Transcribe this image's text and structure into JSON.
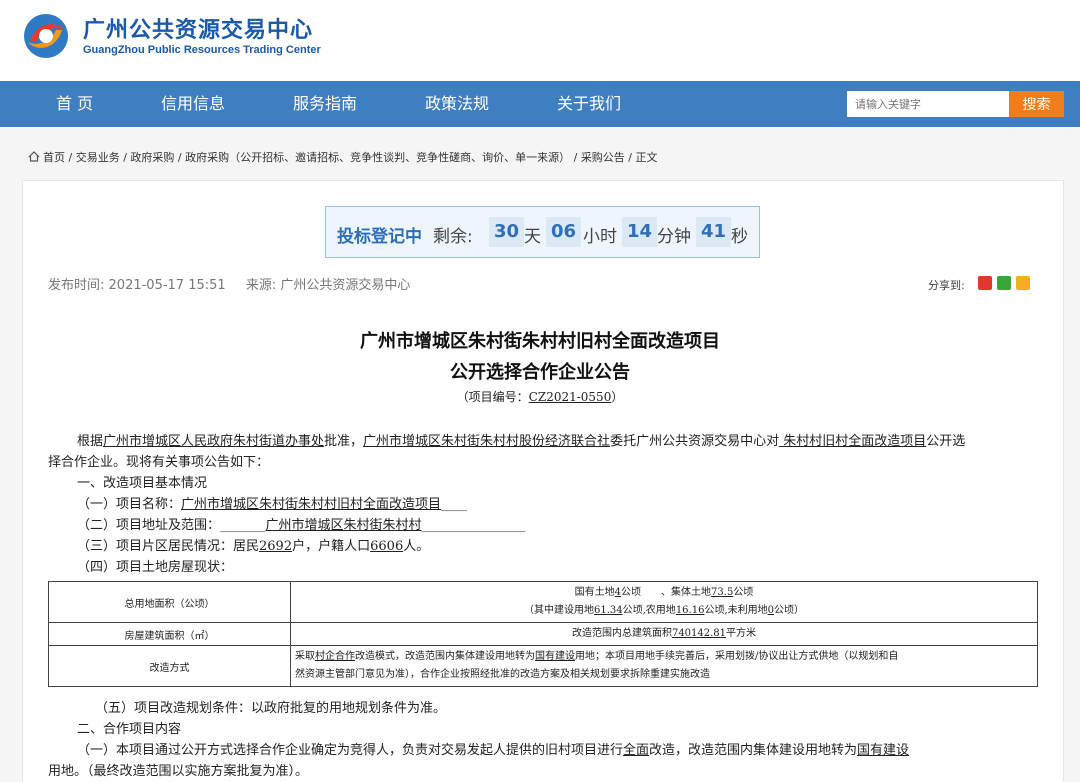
{
  "header": {
    "brand_cn": "广州公共资源交易中心",
    "brand_en": "GuangZhou Public Resources Trading Center"
  },
  "nav": {
    "items": [
      "首 页",
      "信用信息",
      "服务指南",
      "政策法规",
      "关于我们"
    ],
    "search_placeholder": "请输入关键字",
    "search_button": "搜索"
  },
  "breadcrumb": [
    "首页",
    "交易业务",
    "政府采购",
    "政府采购（公开招标、邀请招标、竞争性谈判、竞争性磋商、询价、单一来源）",
    "采购公告",
    "正文"
  ],
  "breadcrumb_sep": " / ",
  "countdown": {
    "title": "投标登记中",
    "remaining_label": "剩余:",
    "days": "30",
    "days_unit": "天",
    "hours": "06",
    "hours_unit": "小时",
    "minutes": "14",
    "minutes_unit": "分钟",
    "seconds": "41",
    "seconds_unit": "秒"
  },
  "meta": {
    "publish_label": "发布时间:",
    "publish_time": "2021-05-17 15:51",
    "source_label": "来源:",
    "source": "广州公共资源交易中心",
    "share_label": "分享到:"
  },
  "article": {
    "title_line1": "广州市增城区朱村街朱村村旧村全面改造项目",
    "title_line2": "公开选择合作企业公告",
    "project_no_prefix": "（项目编号：",
    "project_no": "CZ2021-0550",
    "project_no_suffix": "）",
    "intro_1": "根据",
    "intro_org": "广州市增城区人民政府朱村街道办事处",
    "intro_2": "批准，",
    "intro_coop": "广州市增城区朱村街朱村村股份经济联合社",
    "intro_3": "委托广州公共资源交易中心对",
    "intro_proj": " 朱村村旧村全面改造项目",
    "intro_4": "公开选",
    "intro_line2": "择合作企业。现将有关事项公告如下：",
    "sec1": "一、改造项目基本情况",
    "item1_label": "（一）项目名称：",
    "item1_value": "广州市增城区朱村街朱村村旧村全面改造项目",
    "item1_pad": "____",
    "item2_label": "（二）项目地址及范围：",
    "item2_pad1": "_______",
    "item2_value": "广州市增城区朱村街朱村村",
    "item2_pad2": "________________",
    "item3_label": "（三）项目片区居民情况：居民",
    "item3_households": "2692",
    "item3_mid": "户，户籍人口",
    "item3_population": "6606",
    "item3_end": "人。",
    "item4": "（四）项目土地房屋现状：",
    "item5": "（五）项目改造规划条件：以政府批复的用地规划条件为准。",
    "sec2": "二、合作项目内容",
    "coop_1a": "（一）本项目通过公开方式选择合作企业确定为竞得人，负责对交易发起人提供的旧村项目进行",
    "coop_1b": "全面",
    "coop_1c": "改造，改造范围内集体建设用地转为",
    "coop_1d": "国有建设",
    "coop_line2": "用地。（最终改造范围以实施方案批复为准）。"
  },
  "land_table": {
    "row1_label": "总用地面积（公顷）",
    "row1_line1_a": "国有土地",
    "row1_state": "4",
    "row1_line1_b": "公顷　　、集体土地",
    "row1_collective": "73.5",
    "row1_line1_c": "公顷",
    "row1_line2_a": "（其中建设用地",
    "row1_construction": "61.34",
    "row1_line2_b": "公顷,农用地",
    "row1_farm": "16.16",
    "row1_line2_c": "公顷,未利用地",
    "row1_unused": "0",
    "row1_line2_d": "公顷）",
    "row2_label": "房屋建筑面积（㎡）",
    "row2_a": "改造范围内总建筑面积",
    "row2_area": "740142.81",
    "row2_b": "平方米",
    "row3_label": "改造方式",
    "row3_a": "采取",
    "row3_mode": "村企合作",
    "row3_b": "改造模式，改造范围内集体建设用地转为",
    "row3_use": "国有建设",
    "row3_c": "用地；本项目用地手续完善后，采用划拨/协议出让方式供地（以规划和自",
    "row3_line2": "然资源主管部门意见为准），合作企业按照经批准的改造方案及相关规划要求拆除重建实施改造"
  },
  "colors": {
    "nav": "#3f7fc1",
    "brand": "#1a5aa8",
    "search_button": "#f07d1b"
  }
}
